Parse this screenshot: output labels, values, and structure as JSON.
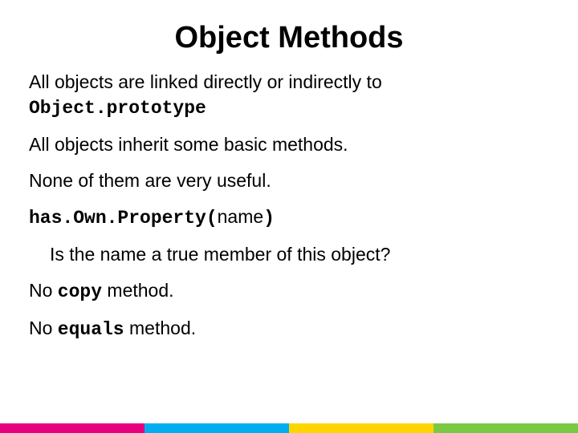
{
  "title": "Object Methods",
  "para1_a": "All objects are linked directly or indirectly to ",
  "para1_code": "Object.prototype",
  "para2": "All objects inherit some basic methods.",
  "para3": "None of them are very useful.",
  "para4_code": "has.Own.Property(",
  "para4_b": "name",
  "para4_c": ")",
  "para5": "Is the name a true member of this object?",
  "para6_a": "No ",
  "para6_code": "copy",
  "para6_b": " method.",
  "para7_a": "No ",
  "para7_code": "equals",
  "para7_b": " method."
}
